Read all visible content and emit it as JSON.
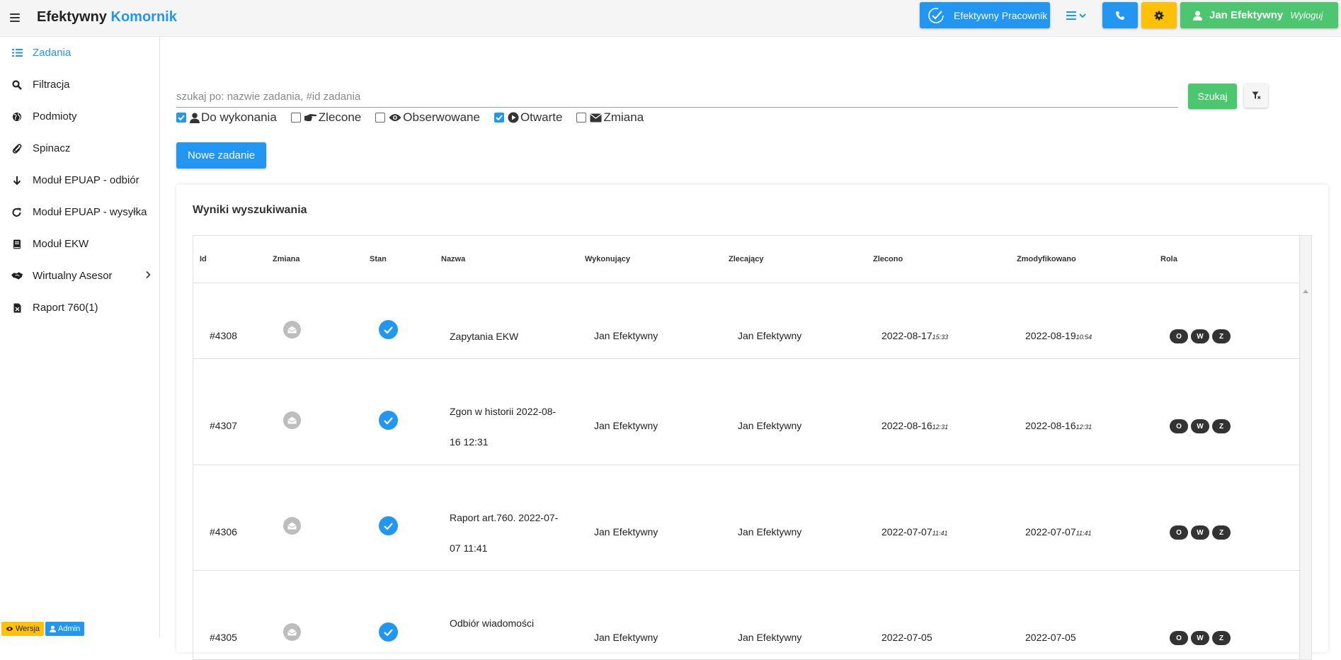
{
  "app": {
    "brand_main": "Efektywny",
    "brand_accent": "Komornik"
  },
  "topbar": {
    "employee_label": "Efektywny Pracownik",
    "user_name": "Jan Efektywny",
    "logout_label": "Wyloguj"
  },
  "sidebar": {
    "items": [
      {
        "label": "Zadania",
        "icon": "tasks-list-icon"
      },
      {
        "label": "Filtracja",
        "icon": "search-icon"
      },
      {
        "label": "Podmioty",
        "icon": "globe-icon"
      },
      {
        "label": "Spinacz",
        "icon": "paperclip-icon"
      },
      {
        "label": "Moduł EPUAP - odbiór",
        "icon": "arrow-down-icon"
      },
      {
        "label": "Moduł EPUAP - wysyłka",
        "icon": "redo-icon"
      },
      {
        "label": "Moduł EKW",
        "icon": "book-icon"
      },
      {
        "label": "Wirtualny Asesor",
        "icon": "handshake-icon"
      },
      {
        "label": "Raport 760(1)",
        "icon": "excel-file-icon"
      }
    ],
    "badge_version": "Wersja",
    "badge_admin": "Admin"
  },
  "search": {
    "placeholder": "szukaj po: nazwie zadania, #id zadania",
    "button_label": "Szukaj"
  },
  "filters": [
    {
      "label": "Do wykonania",
      "checked": true
    },
    {
      "label": "Zlecone",
      "checked": false
    },
    {
      "label": "Obserwowane",
      "checked": false
    },
    {
      "label": "Otwarte",
      "checked": true
    },
    {
      "label": "Zmiana",
      "checked": false
    }
  ],
  "new_task_label": "Nowe zadanie",
  "results": {
    "title": "Wyniki wyszukiwania",
    "columns": [
      "Id",
      "Zmiana",
      "Stan",
      "Nazwa",
      "Wykonujący",
      "Zlecający",
      "Zlecono",
      "Zmodyfikowano",
      "Rola"
    ],
    "roles": [
      "O",
      "W",
      "Z"
    ],
    "rows": [
      {
        "id": "#4308",
        "name": "Zapytania EKW",
        "wyk": "Jan Efektywny",
        "zle": "Jan Efektywny",
        "zlecono_date": "2022-08-17",
        "zlecono_time": "15:33",
        "mod_date": "2022-08-19",
        "mod_time": "10:54"
      },
      {
        "id": "#4307",
        "name": "Zgon w historii 2022-08-16 12:31",
        "wyk": "Jan Efektywny",
        "zle": "Jan Efektywny",
        "zlecono_date": "2022-08-16",
        "zlecono_time": "12:31",
        "mod_date": "2022-08-16",
        "mod_time": "12:31"
      },
      {
        "id": "#4306",
        "name": "Raport art.760. 2022-07-07 11:41",
        "wyk": "Jan Efektywny",
        "zle": "Jan Efektywny",
        "zlecono_date": "2022-07-07",
        "zlecono_time": "11:41",
        "mod_date": "2022-07-07",
        "mod_time": "11:41"
      },
      {
        "id": "#4305",
        "name": "Odbiór wiadomości",
        "wyk": "Jan Efektywny",
        "zle": "Jan Efektywny",
        "zlecono_date": "2022-07-05",
        "zlecono_time": "",
        "mod_date": "2022-07-05",
        "mod_time": ""
      }
    ]
  },
  "colors": {
    "primary": "#2196f3",
    "success": "#4cc76f",
    "warning": "#ffc107",
    "dark": "#333333"
  }
}
